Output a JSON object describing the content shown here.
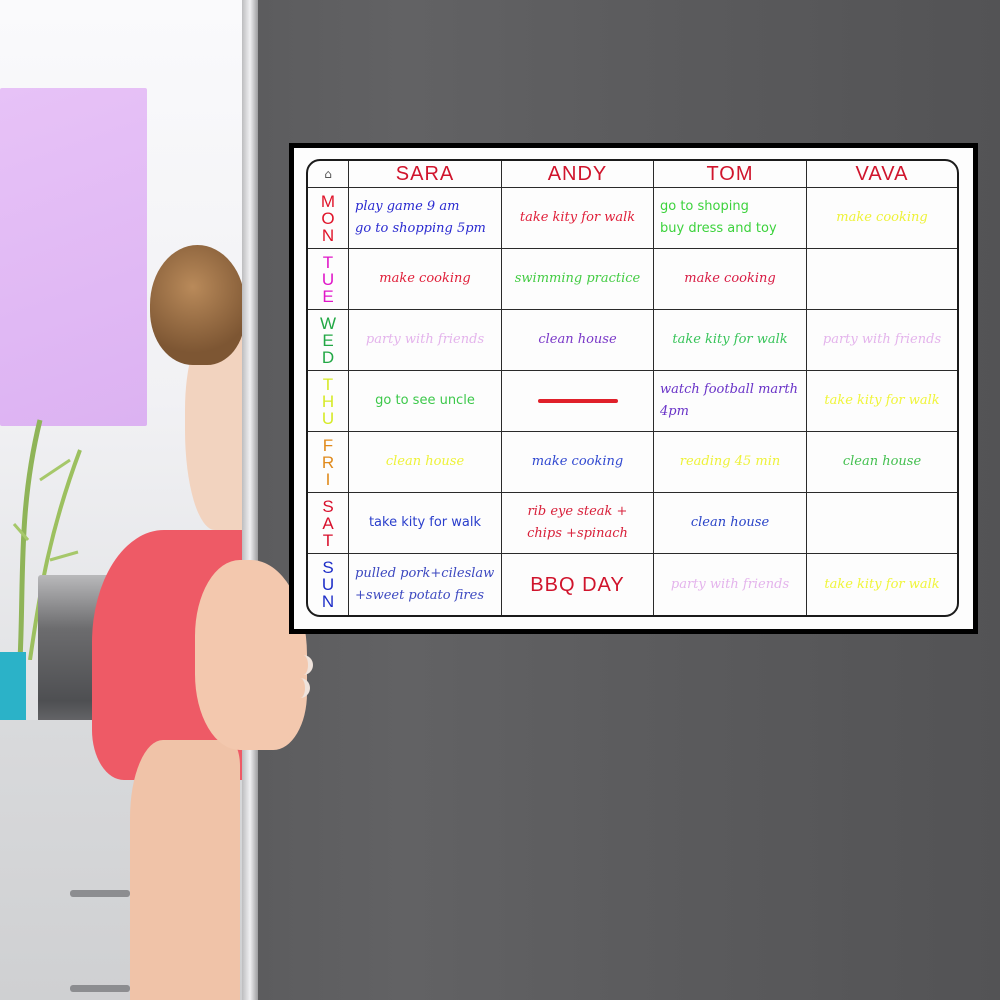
{
  "planner": {
    "corner_icon": "house-icon",
    "people": [
      {
        "name": "SARA",
        "color": "#d0142c"
      },
      {
        "name": "ANDY",
        "color": "#d0142c"
      },
      {
        "name": "TOM",
        "color": "#d0142c"
      },
      {
        "name": "VAVA",
        "color": "#d0142c"
      }
    ],
    "days": [
      {
        "label": "MON",
        "color": "#e0142a"
      },
      {
        "label": "TUE",
        "color": "#e016c8"
      },
      {
        "label": "WED",
        "color": "#22a845"
      },
      {
        "label": "THU",
        "color": "#d6ea28"
      },
      {
        "label": "FRI",
        "color": "#e08a1c"
      },
      {
        "label": "SAT",
        "color": "#d8102c"
      },
      {
        "label": "SUN",
        "color": "#1e2ec8"
      }
    ],
    "entries": [
      [
        {
          "lines": [
            "play game 9 am",
            "go to shopping 5pm"
          ],
          "color": "#2a2ad0",
          "style": "script",
          "align": "left"
        },
        {
          "lines": [
            "take kity for walk"
          ],
          "color": "#e0203a",
          "style": "script"
        },
        {
          "lines": [
            "go to shoping",
            "buy dress and toy"
          ],
          "color": "#3cd23c",
          "style": "print",
          "align": "left"
        },
        {
          "lines": [
            "make cooking"
          ],
          "color": "#eef23a",
          "style": "script"
        }
      ],
      [
        {
          "lines": [
            "make cooking"
          ],
          "color": "#e0203a",
          "style": "script"
        },
        {
          "lines": [
            "swimming practice"
          ],
          "color": "#44cc44",
          "style": "script"
        },
        {
          "lines": [
            "make cooking"
          ],
          "color": "#d81c44",
          "style": "script"
        },
        {
          "lines": [],
          "color": "",
          "style": "script"
        }
      ],
      [
        {
          "lines": [
            "party with friends"
          ],
          "color": "#e4b4ec",
          "style": "script"
        },
        {
          "lines": [
            "clean house"
          ],
          "color": "#7a38c8",
          "style": "script"
        },
        {
          "lines": [
            "take kity for walk"
          ],
          "color": "#38c45a",
          "style": "script"
        },
        {
          "lines": [
            "party with friends"
          ],
          "color": "#e4b4ec",
          "style": "script"
        }
      ],
      [
        {
          "lines": [
            "go to see uncle"
          ],
          "color": "#3cc84a",
          "style": "print"
        },
        {
          "lines": [],
          "color": "#e0202a",
          "style": "dash"
        },
        {
          "lines": [
            "watch football marth",
            "4pm"
          ],
          "color": "#6a34c8",
          "style": "script",
          "align": "left"
        },
        {
          "lines": [
            "take kity for walk"
          ],
          "color": "#f0f53a",
          "style": "script"
        }
      ],
      [
        {
          "lines": [
            "clean house"
          ],
          "color": "#eef23a",
          "style": "script"
        },
        {
          "lines": [
            "make cooking"
          ],
          "color": "#3048d0",
          "style": "script"
        },
        {
          "lines": [
            "reading 45 min"
          ],
          "color": "#eef23a",
          "style": "script"
        },
        {
          "lines": [
            "clean house"
          ],
          "color": "#44c050",
          "style": "script"
        }
      ],
      [
        {
          "lines": [
            "take kity for walk"
          ],
          "color": "#2a3ecc",
          "style": "print"
        },
        {
          "lines": [
            "rib eye steak +",
            "chips +spinach"
          ],
          "color": "#d8203a",
          "style": "script"
        },
        {
          "lines": [
            "clean house"
          ],
          "color": "#2a44c8",
          "style": "script"
        },
        {
          "lines": [],
          "color": "",
          "style": "script"
        }
      ],
      [
        {
          "lines": [
            "pulled pork+cileslaw",
            "+sweet potato fires"
          ],
          "color": "#3c48c0",
          "style": "script",
          "align": "left"
        },
        {
          "lines": [
            "BBQ DAY"
          ],
          "color": "#d0142c",
          "style": "big"
        },
        {
          "lines": [
            "party with friends"
          ],
          "color": "#e4b4ec",
          "style": "script"
        },
        {
          "lines": [
            "take kity for walk"
          ],
          "color": "#f0f53a",
          "style": "script"
        }
      ]
    ]
  },
  "scene": {
    "description": "Woman peeking from behind a dark grey refrigerator door holding a magnetic weekly planner whiteboard",
    "fridge_color": "#5c5c5e",
    "shirt_color": "#ee5a66",
    "cabinet_color": "#e2bbf6",
    "pot_color": "#2bb2c8"
  }
}
